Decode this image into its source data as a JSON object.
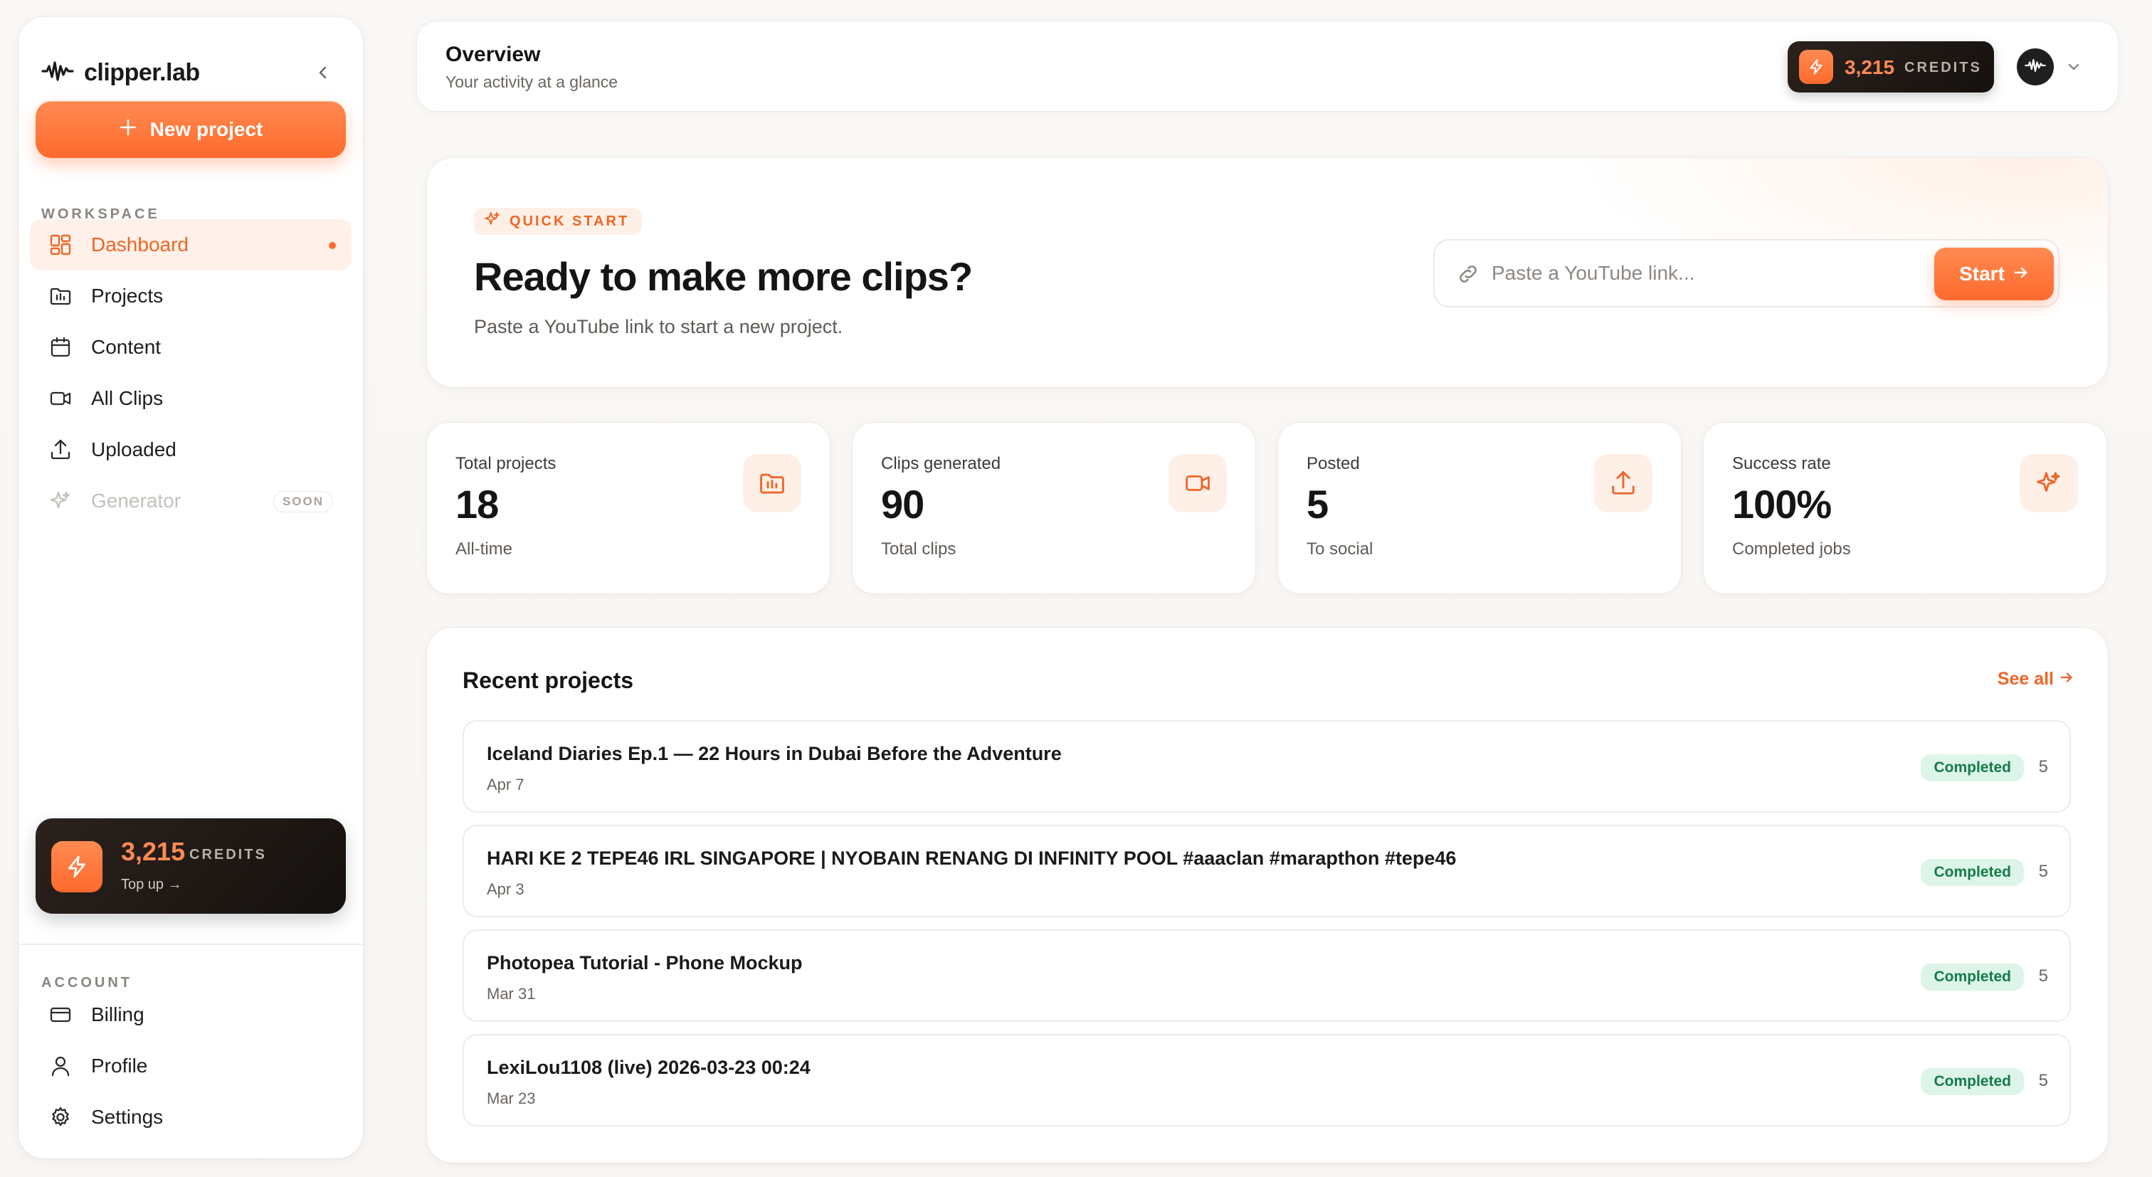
{
  "sidebar": {
    "brand": "clipper.lab",
    "new_project_label": "New project",
    "workspace_label": "WORKSPACE",
    "account_label": "ACCOUNT",
    "workspace_items": [
      {
        "label": "Dashboard",
        "icon": "dashboard-icon",
        "active": true
      },
      {
        "label": "Projects",
        "icon": "folder-icon"
      },
      {
        "label": "Content",
        "icon": "calendar-icon"
      },
      {
        "label": "All Clips",
        "icon": "video-icon"
      },
      {
        "label": "Uploaded",
        "icon": "upload-icon"
      },
      {
        "label": "Generator",
        "icon": "sparkle-icon",
        "disabled": true,
        "badge": "SOON"
      }
    ],
    "account_items": [
      {
        "label": "Billing",
        "icon": "credit-card-icon"
      },
      {
        "label": "Profile",
        "icon": "user-icon"
      },
      {
        "label": "Settings",
        "icon": "gear-icon"
      }
    ],
    "credits": {
      "amount": "3,215",
      "unit": "CREDITS",
      "topup": "Top up →"
    }
  },
  "header": {
    "title": "Overview",
    "subtitle": "Your activity at a glance",
    "credits": {
      "amount": "3,215",
      "unit": "CREDITS"
    }
  },
  "quick_start": {
    "badge": "QUICK START",
    "title": "Ready to make more clips?",
    "subtitle": "Paste a YouTube link to start a new project.",
    "input_placeholder": "Paste a YouTube link...",
    "start_label": "Start"
  },
  "stats": [
    {
      "label": "Total projects",
      "value": "18",
      "foot": "All-time",
      "icon": "folder-icon"
    },
    {
      "label": "Clips generated",
      "value": "90",
      "foot": "Total clips",
      "icon": "video-icon"
    },
    {
      "label": "Posted",
      "value": "5",
      "foot": "To social",
      "icon": "upload-icon"
    },
    {
      "label": "Success rate",
      "value": "100%",
      "foot": "Completed jobs",
      "icon": "sparkle-icon"
    }
  ],
  "recent": {
    "title": "Recent projects",
    "see_all": "See all",
    "projects": [
      {
        "name": "Iceland Diaries Ep.1 — 22 Hours in Dubai Before the Adventure",
        "date": "Apr 7",
        "status": "Completed",
        "count": "5"
      },
      {
        "name": "HARI KE 2 TEPE46 IRL SINGAPORE | NYOBAIN RENANG DI INFINITY POOL #aaaclan #marapthon #tepe46",
        "date": "Apr 3",
        "status": "Completed",
        "count": "5"
      },
      {
        "name": "Photopea Tutorial - Phone Mockup",
        "date": "Mar 31",
        "status": "Completed",
        "count": "5"
      },
      {
        "name": "LexiLou1108 (live) 2026-03-23 00:24",
        "date": "Mar 23",
        "status": "Completed",
        "count": "5"
      }
    ]
  },
  "colors": {
    "accent": "#ff6a2c",
    "accent_text": "#f06527",
    "success_bg": "#ddf5e9",
    "success_text": "#157a4a",
    "dark_card": "#1b1512"
  }
}
